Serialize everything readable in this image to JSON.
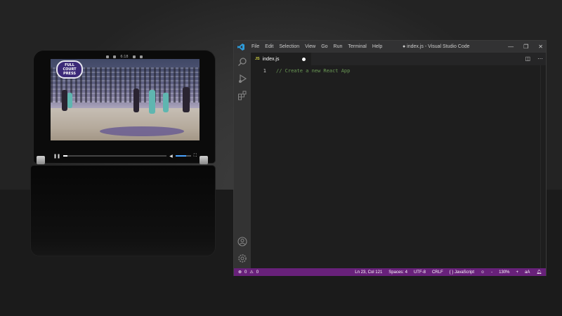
{
  "device": {
    "status_time": "6:18",
    "video": {
      "logo_text_1": "FULL COURT",
      "logo_text_2": "PRESS",
      "progress_fraction": 0.04,
      "volume_fraction": 0.7
    }
  },
  "vscode": {
    "menu": [
      "File",
      "Edit",
      "Selection",
      "View",
      "Go",
      "Run",
      "Terminal",
      "Help"
    ],
    "window_title": "● index.js - Visual Studio Code",
    "tab": {
      "badge": "JS",
      "filename": "index.js"
    },
    "editor": {
      "lines": [
        {
          "number": "1",
          "text": "// Create a new React App"
        }
      ]
    },
    "status": {
      "errors": "0",
      "warnings": "0",
      "position": "Ln 23, Col 121",
      "spaces": "Spaces: 4",
      "encoding": "UTF-8",
      "eol": "CRLF",
      "language": "JavaScript",
      "zoom_out": "-",
      "zoom": "130%",
      "zoom_in": "+"
    }
  },
  "colors": {
    "statusbar": "#68217a",
    "accent_blue": "#0078d4",
    "comment_green": "#6a9955"
  }
}
